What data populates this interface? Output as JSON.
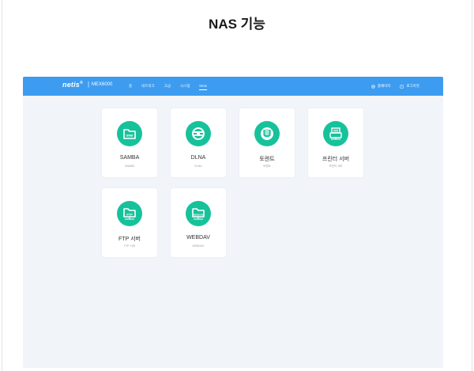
{
  "page_title": "NAS 기능",
  "brand": {
    "name": "netis",
    "sup": "®",
    "separator": "|",
    "model": "MEX6000"
  },
  "nav": [
    {
      "label": "홈"
    },
    {
      "label": "네트워크"
    },
    {
      "label": "고급"
    },
    {
      "label": "시스템"
    },
    {
      "label": "NAS",
      "active": true
    }
  ],
  "actions": {
    "home_label": "홈페이지",
    "logout_label": "로그아웃"
  },
  "cards": [
    {
      "label": "SAMBA",
      "sub": "SAMBA",
      "icon": "smb-folder-icon"
    },
    {
      "label": "DLNA",
      "sub": "DLNA",
      "icon": "dlna-icon"
    },
    {
      "label": "토렌트",
      "sub": "토렌트",
      "icon": "torrent-icon"
    },
    {
      "label": "프린터 서버",
      "sub": "프린터 서버",
      "icon": "printer-icon"
    },
    {
      "label": "FTP 서버",
      "sub": "FTP 서버",
      "icon": "ftp-folder-icon"
    },
    {
      "label": "WEBDAV",
      "sub": "WEBDAV",
      "icon": "webdav-folder-icon"
    }
  ],
  "colors": {
    "topbar": "#3d9cf0",
    "accent": "#17c29b",
    "background": "#f1f4f8"
  }
}
